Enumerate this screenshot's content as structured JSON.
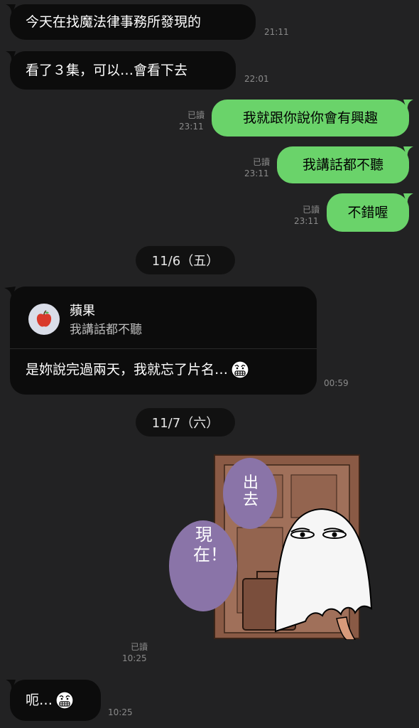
{
  "messages": [
    {
      "text": "今天在找魔法律事務所發現的",
      "time": "21:11"
    },
    {
      "text": "看了３集，可以…會看下去",
      "time": "22:01"
    },
    {
      "text": "我就跟你說你會有興趣",
      "read": "已讀",
      "time": "23:11"
    },
    {
      "text": "我講話都不聽",
      "read": "已讀",
      "time": "23:11"
    },
    {
      "text": "不錯喔",
      "read": "已讀",
      "time": "23:11"
    }
  ],
  "date_1": "11/6（五）",
  "reply": {
    "quoted_name": "蘋果",
    "quoted_text": "我講話都不聽",
    "text": "是妳說完過兩天，我就忘了片名…",
    "time": "00:59"
  },
  "date_2": "11/7（六）",
  "sticker": {
    "bubble_1": "出去",
    "bubble_2": "現在！",
    "read": "已讀",
    "time": "10:25"
  },
  "last_message": {
    "text": "呃…",
    "time": "10:25"
  },
  "colors": {
    "background": "#222223",
    "received_bubble": "#0c0c0c",
    "sent_bubble": "#6ad36a",
    "meta_text": "#8a8a8a",
    "sticker_speech": "#8a74a8"
  },
  "icons": [
    "apple-avatar-icon",
    "grimace-emoji-icon"
  ]
}
